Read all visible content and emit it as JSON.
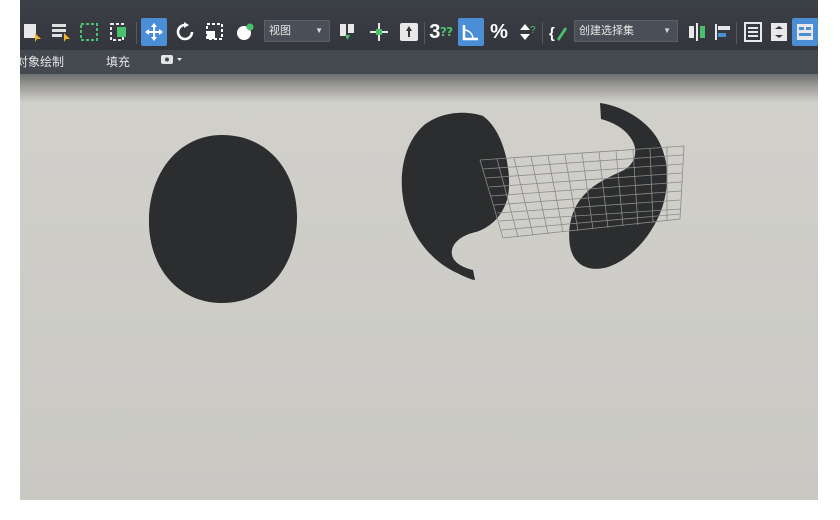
{
  "toolbar": {
    "view_dropdown": "视图",
    "selection_set_dropdown": "创建选择集",
    "snap_3_label": "3",
    "angle_snap_label": "",
    "percent_snap_label": "%"
  },
  "ribbon": {
    "object_paint": "对象绘制",
    "fill": "填充"
  },
  "colors": {
    "toolbar_bg": "#3a3e44",
    "accent_blue": "#4a8fd6",
    "viewport_bg": "#cfcec9",
    "shape_fill": "#2c2d2e"
  },
  "viewport": {
    "objects": [
      "circle",
      "left-half-yinyang",
      "right-half-yinyang",
      "wire-grid-plane"
    ]
  }
}
